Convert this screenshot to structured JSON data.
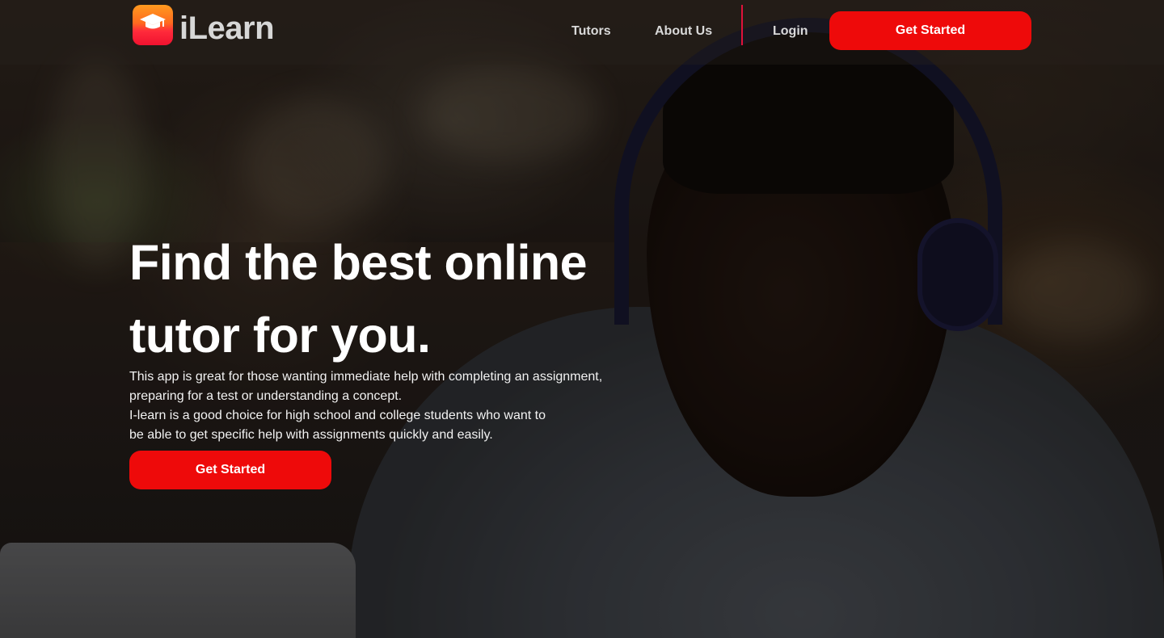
{
  "brand": {
    "name": "iLearn",
    "logo_icon": "graduation-cap-icon",
    "logo_gradient": [
      "#ff9a1f",
      "#f0122f"
    ]
  },
  "nav": {
    "links": [
      "Tutors",
      "About Us"
    ],
    "login": "Login",
    "cta": "Get Started"
  },
  "hero": {
    "title_line1": "Find the best online",
    "title_line2": "tutor for you.",
    "description_lines": [
      "This app is great for those wanting immediate help with completing an assignment,",
      "preparing for a test or understanding a concept.",
      "I-learn is a good choice for high school and college students who want to",
      "be able to get specific help with assignments quickly and easily."
    ],
    "cta": "Get Started"
  },
  "colors": {
    "accent": "#ee0a0a",
    "divider": "#e0123a",
    "nav_text": "#d9d9d9",
    "hero_text": "#ffffff"
  }
}
